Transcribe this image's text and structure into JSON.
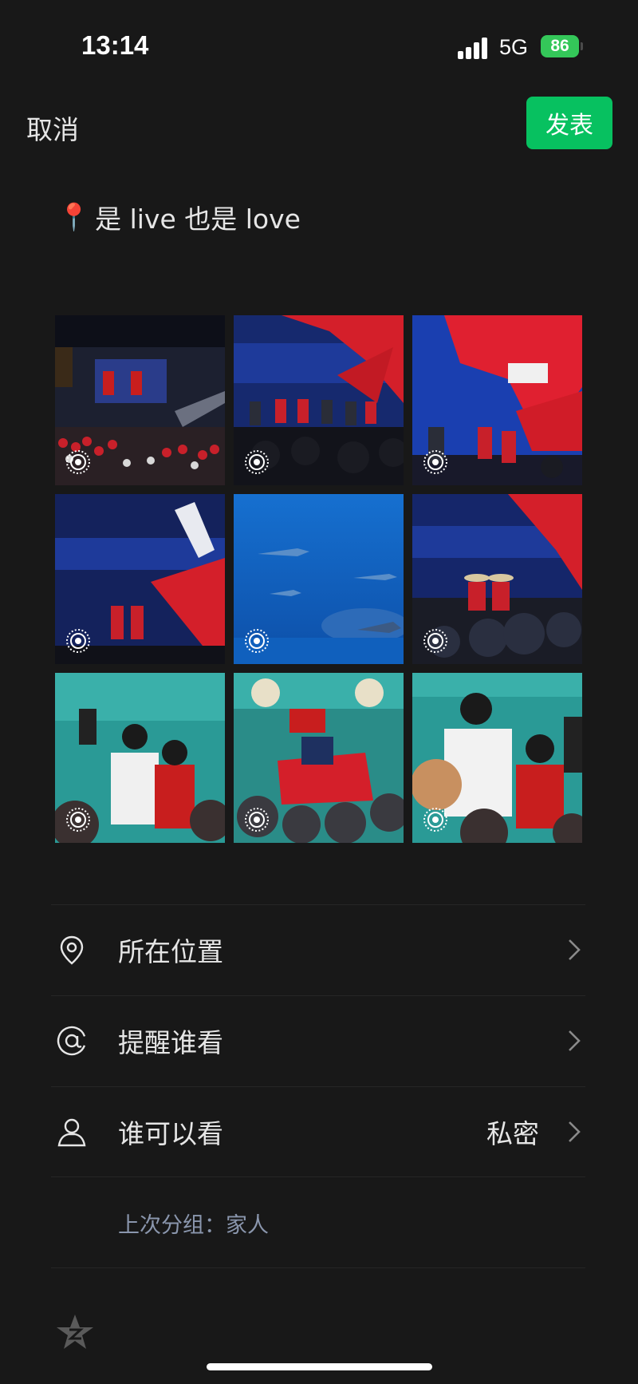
{
  "status_bar": {
    "time": "13:14",
    "network": "5G",
    "battery": "86"
  },
  "top_bar": {
    "cancel_label": "取消",
    "post_label": "发表"
  },
  "caption": {
    "pin_glyph": "📍",
    "text": "是 live 也是 love"
  },
  "photos": [
    {
      "scene": "arena-screen-crowd",
      "live": true
    },
    {
      "scene": "doubles-award-ceremony",
      "live": true
    },
    {
      "scene": "championship-finals-stage",
      "live": true
    },
    {
      "scene": "mixed-doubles-award-ceremony",
      "live": true
    },
    {
      "scene": "aquarium-sharks",
      "live": true
    },
    {
      "scene": "winners-on-stage-cowboy-hats",
      "live": true
    },
    {
      "scene": "players-with-press",
      "live": true
    },
    {
      "scene": "team-with-flag",
      "live": true
    },
    {
      "scene": "players-interview",
      "live": true
    }
  ],
  "options": {
    "location": {
      "label": "所在位置",
      "icon": "location-pin-icon"
    },
    "remind": {
      "label": "提醒谁看",
      "icon": "at-sign-icon"
    },
    "visibility": {
      "label": "谁可以看",
      "value": "私密",
      "icon": "person-icon"
    }
  },
  "last_group": "上次分组：家人",
  "colors": {
    "background": "#181818",
    "accent": "#07c160",
    "muted": "#8a96ad"
  }
}
